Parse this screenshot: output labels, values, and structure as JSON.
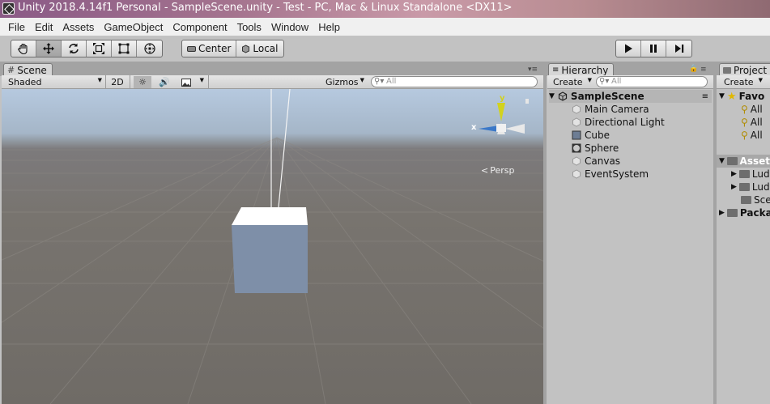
{
  "window": {
    "title": "Unity 2018.4.14f1 Personal - SampleScene.unity - Test - PC, Mac & Linux Standalone <DX11>"
  },
  "menu": [
    "File",
    "Edit",
    "Assets",
    "GameObject",
    "Component",
    "Tools",
    "Window",
    "Help"
  ],
  "toolbar": {
    "pivot_label": "Center",
    "space_label": "Local"
  },
  "scene": {
    "tab_label": "Scene",
    "shading_mode": "Shaded",
    "mode_2d": "2D",
    "gizmos_label": "Gizmos",
    "search_placeholder": "All",
    "persp_label": "Persp",
    "gizmo_axis_y": "y",
    "gizmo_axis_x": "x"
  },
  "hierarchy": {
    "tab_label": "Hierarchy",
    "create_label": "Create",
    "search_placeholder": "All",
    "scene_name": "SampleScene",
    "items": [
      {
        "label": "Main Camera",
        "icon": "gameobject-icon"
      },
      {
        "label": "Directional Light",
        "icon": "gameobject-icon"
      },
      {
        "label": "Cube",
        "icon": "cube-mesh-icon"
      },
      {
        "label": "Sphere",
        "icon": "sphere-mesh-icon"
      },
      {
        "label": "Canvas",
        "icon": "gameobject-icon"
      },
      {
        "label": "EventSystem",
        "icon": "gameobject-icon"
      }
    ]
  },
  "project": {
    "tab_label": "Project",
    "create_label": "Create",
    "favorites_label": "Favo",
    "favorites": [
      "All",
      "All",
      "All"
    ],
    "assets_label": "Asset",
    "assets_children": [
      "Lud",
      "Lud",
      "Sce"
    ],
    "packages_label": "Packa"
  },
  "colors": {
    "editor_bg": "#c2c2c2",
    "accent": "#3d6fb6",
    "gizmo_y": "#c8c81a",
    "gizmo_x": "#3b78c8"
  }
}
